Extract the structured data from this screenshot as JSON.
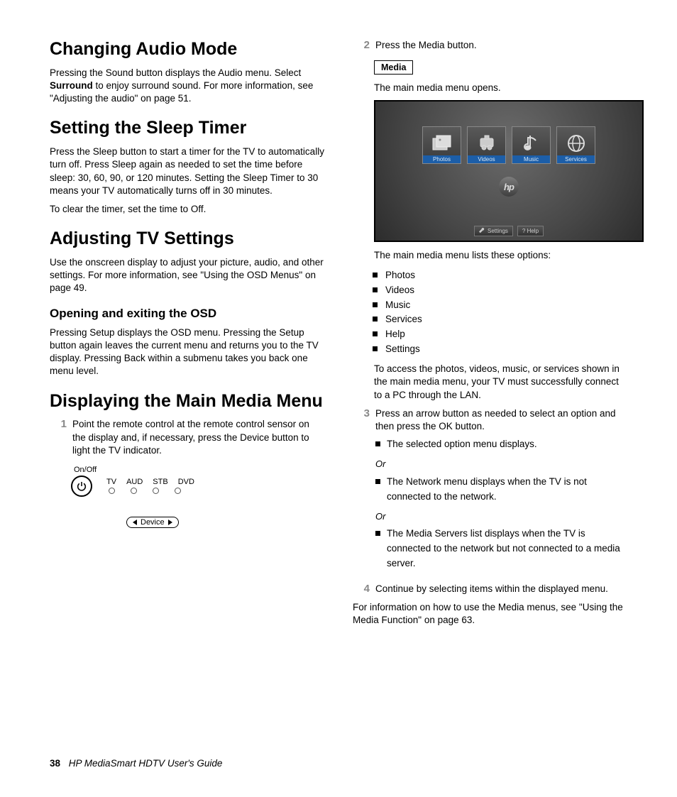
{
  "left": {
    "h1_audio": "Changing Audio Mode",
    "p_audio_a": "Pressing the Sound button displays the Audio menu. Select ",
    "p_audio_bold": "Surround",
    "p_audio_b": " to enjoy surround sound. For more information, see \"Adjusting the audio\" on page 51.",
    "h1_sleep": "Setting the Sleep Timer",
    "p_sleep1": "Press the Sleep button to start a timer for the TV to automatically turn off. Press Sleep again as needed to set the time before sleep: 30, 60, 90, or 120 minutes. Setting the Sleep Timer to 30 means your TV automatically turns off in 30 minutes.",
    "p_sleep2": "To clear the timer, set the time to Off.",
    "h1_adjust": "Adjusting TV Settings",
    "p_adjust": "Use the onscreen display to adjust your picture, audio, and other settings. For more information, see \"Using the OSD Menus\" on page 49.",
    "h2_osd": "Opening and exiting the OSD",
    "p_osd": "Pressing Setup displays the OSD menu. Pressing the Setup button again leaves the current menu and returns you to the TV display. Pressing Back within a submenu takes you back one menu level.",
    "h1_media": "Displaying the Main Media Menu",
    "step1_num": "1",
    "step1": "Point the remote control at the remote control sensor on the display and, if necessary, press the Device button to light the TV indicator.",
    "remote": {
      "onoff": "On/Off",
      "devs": [
        "TV",
        "AUD",
        "STB",
        "DVD"
      ],
      "device_btn": "Device"
    }
  },
  "right": {
    "step2_num": "2",
    "step2": "Press the Media button.",
    "media_btn": "Media",
    "p_open": "The main media menu opens.",
    "tiles": [
      {
        "label": "Photos"
      },
      {
        "label": "Videos"
      },
      {
        "label": "Music"
      },
      {
        "label": "Services"
      }
    ],
    "hp": "hp",
    "bb_settings": "Settings",
    "bb_help": "? Help",
    "p_lists": "The main media menu lists these options:",
    "options": [
      "Photos",
      "Videos",
      "Music",
      "Services",
      "Help",
      "Settings"
    ],
    "p_access": "To access the photos, videos, music, or services shown in the main media menu, your TV must successfully connect to a PC through the LAN.",
    "step3_num": "3",
    "step3": "Press an arrow button as needed to select an option and then press the OK button.",
    "sub_a": "The selected option menu displays.",
    "or": "Or",
    "sub_b": "The Network menu displays when the TV is not connected to the network.",
    "sub_c": "The Media Servers list displays when the TV is connected to the network but not connected to a media server.",
    "step4_num": "4",
    "step4": "Continue by selecting items within the displayed menu.",
    "p_info": "For information on how to use the Media menus, see \"Using the Media Function\" on page 63."
  },
  "footer": {
    "page": "38",
    "title": "HP MediaSmart HDTV User's Guide"
  }
}
